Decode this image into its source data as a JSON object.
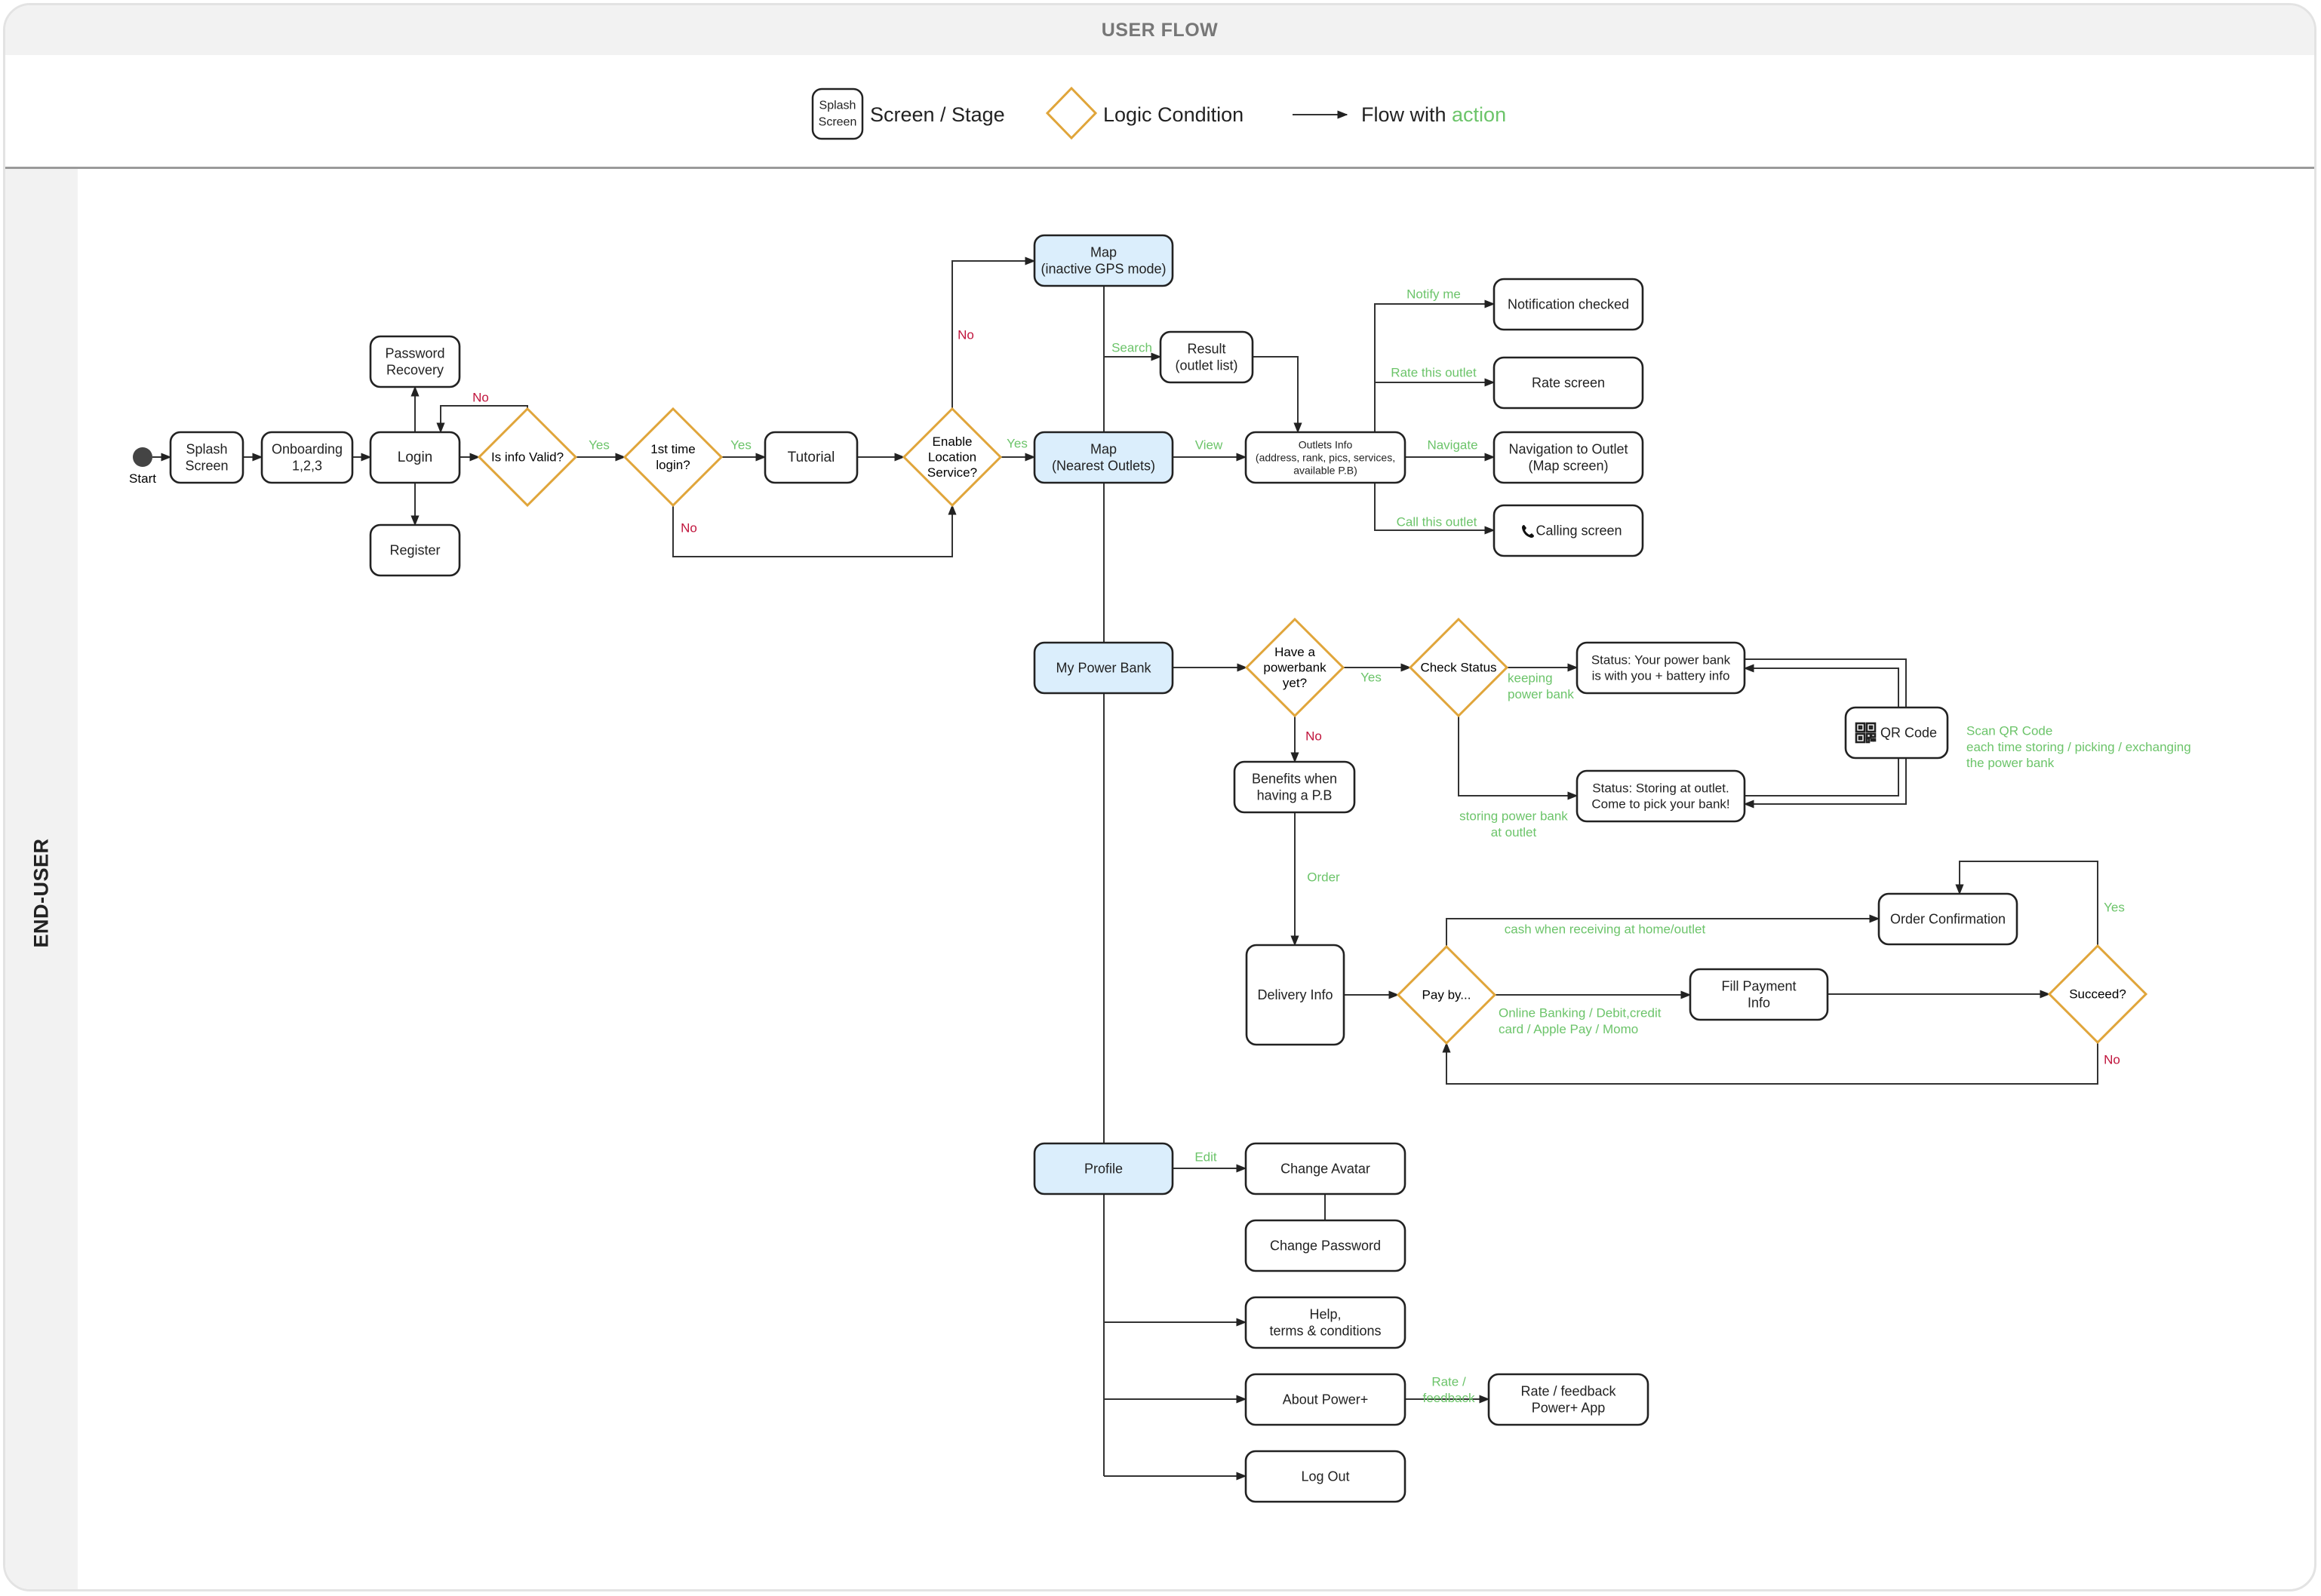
{
  "header": {
    "title": "USER FLOW"
  },
  "legend": {
    "screen_sample": [
      "Splash",
      "Screen"
    ],
    "screen_label": "Screen / Stage",
    "logic_label": "Logic Condition",
    "flow_label_prefix": "Flow with ",
    "flow_label_action": "action"
  },
  "lane": {
    "label": "END-USER"
  },
  "colors": {
    "decision_stroke": "#e0a53a",
    "primary_fill": "#dbeefc",
    "action_green": "#6cc46a",
    "negative_red": "#c0143c",
    "title_bar": "#f2f2f2"
  },
  "start": {
    "label": "Start"
  },
  "nodes": {
    "splash": [
      "Splash",
      "Screen"
    ],
    "onboarding": [
      "Onboarding",
      "1,2,3"
    ],
    "login": [
      "Login"
    ],
    "password_recovery": [
      "Password",
      "Recovery"
    ],
    "register": [
      "Register"
    ],
    "tutorial": [
      "Tutorial"
    ],
    "map_inactive": [
      "Map",
      "(inactive GPS mode)"
    ],
    "map_nearest": [
      "Map",
      "(Nearest Outlets)"
    ],
    "result": [
      "Result",
      "(outlet list)"
    ],
    "outlets_info": [
      "Outlets Info",
      "(address, rank, pics, services,",
      "available P.B)"
    ],
    "notification_checked": [
      "Notification checked"
    ],
    "rate_screen": [
      "Rate screen"
    ],
    "navigation": [
      "Navigation to Outlet",
      "(Map screen)"
    ],
    "calling": [
      "Calling screen"
    ],
    "my_power_bank": [
      "My Power Bank"
    ],
    "benefits": [
      "Benefits when",
      "having a P.B"
    ],
    "status_with_you": [
      "Status: Your power bank",
      "is with you + battery info"
    ],
    "status_storing": [
      "Status: Storing at outlet.",
      "Come to pick your bank!"
    ],
    "qr_code": [
      "QR Code"
    ],
    "delivery_info": [
      "Delivery Info"
    ],
    "fill_payment": [
      "Fill Payment",
      "Info"
    ],
    "order_confirmation": [
      "Order Confirmation"
    ],
    "profile": [
      "Profile"
    ],
    "change_avatar": [
      "Change Avatar"
    ],
    "change_password": [
      "Change Password"
    ],
    "help": [
      "Help,",
      "terms & conditions"
    ],
    "about": [
      "About  Power+"
    ],
    "rate_feedback": [
      "Rate / feedback",
      "Power+  App"
    ],
    "log_out": [
      "Log Out"
    ]
  },
  "decisions": {
    "info_valid": [
      "Is info Valid?"
    ],
    "first_login": [
      "1st time",
      "login?"
    ],
    "enable_location": [
      "Enable",
      "Location",
      "Service?"
    ],
    "have_powerbank": [
      "Have a",
      "powerbank",
      "yet?"
    ],
    "check_status": [
      "Check Status"
    ],
    "pay_by": [
      "Pay by..."
    ],
    "succeed": [
      "Succeed?"
    ]
  },
  "edge_labels": {
    "info_valid_no": "No",
    "info_valid_yes": "Yes",
    "first_login_yes": "Yes",
    "first_login_no": "No",
    "location_no": "No",
    "location_yes": "Yes",
    "search": "Search",
    "view": "View",
    "notify_me": "Notify me",
    "rate_outlet": "Rate this outlet",
    "navigate": "Navigate",
    "call_outlet": "Call this outlet",
    "have_pb_yes": "Yes",
    "have_pb_no": "No",
    "keeping": [
      "keeping",
      "power bank"
    ],
    "storing": [
      "storing power bank",
      "at outlet"
    ],
    "scan_qr": [
      "Scan QR Code",
      "each time storing / picking / exchanging",
      "the power bank"
    ],
    "order": "Order",
    "cash": "cash when receiving at home/outlet",
    "online": [
      "Online Banking / Debit,credit",
      "card / Apple Pay / Momo"
    ],
    "succeed_yes": "Yes",
    "succeed_no": "No",
    "edit": "Edit",
    "rate_feedback": [
      "Rate /",
      "feedback"
    ]
  },
  "icons": {
    "phone": "phone-icon",
    "qr": "qr-code-icon"
  }
}
